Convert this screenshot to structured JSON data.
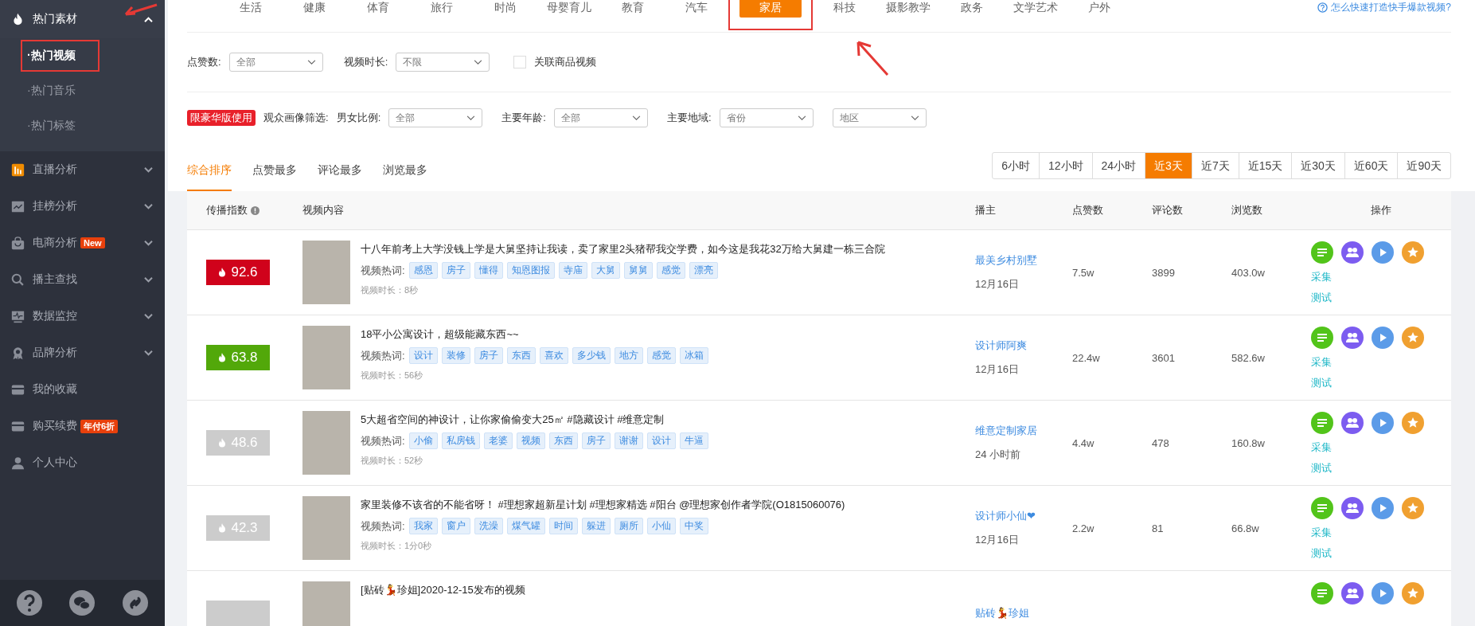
{
  "sidebar": {
    "items": [
      {
        "label": "热门素材",
        "selected": true,
        "expanded": true,
        "children": [
          {
            "label": "·热门视频",
            "selected": true,
            "highlighted": true
          },
          {
            "label": "·热门音乐",
            "selected": false,
            "highlighted": false
          },
          {
            "label": "·热门标签",
            "selected": false,
            "highlighted": false
          }
        ]
      },
      {
        "label": "直播分析",
        "selected": false,
        "expanded": false
      },
      {
        "label": "挂榜分析",
        "selected": false,
        "expanded": false
      },
      {
        "label": "电商分析",
        "selected": false,
        "expanded": false,
        "badge": "New"
      },
      {
        "label": "播主查找",
        "selected": false,
        "expanded": false
      },
      {
        "label": "数据监控",
        "selected": false,
        "expanded": false
      },
      {
        "label": "品牌分析",
        "selected": false,
        "expanded": false
      },
      {
        "label": "我的收藏",
        "selected": false
      },
      {
        "label": "购买续费",
        "selected": false,
        "badge": "年付6折"
      },
      {
        "label": "个人中心",
        "selected": false
      }
    ]
  },
  "categories": [
    {
      "label": "生活",
      "selected": false
    },
    {
      "label": "健康",
      "selected": false
    },
    {
      "label": "体育",
      "selected": false
    },
    {
      "label": "旅行",
      "selected": false
    },
    {
      "label": "时尚",
      "selected": false
    },
    {
      "label": "母婴育儿",
      "selected": false
    },
    {
      "label": "教育",
      "selected": false
    },
    {
      "label": "汽车",
      "selected": false
    },
    {
      "label": "家居",
      "selected": true,
      "highlighted": true
    },
    {
      "label": "科技",
      "selected": false
    },
    {
      "label": "摄影教学",
      "selected": false
    },
    {
      "label": "政务",
      "selected": false
    },
    {
      "label": "文学艺术",
      "selected": false
    },
    {
      "label": "户外",
      "selected": false
    }
  ],
  "help_link": "怎么快速打造快手爆款视频?",
  "filters": {
    "likes": {
      "label": "点赞数:",
      "value": "全部"
    },
    "duration": {
      "label": "视频时长:",
      "value": "不限"
    },
    "related_goods": {
      "label": "关联商品视频",
      "checked": false
    }
  },
  "audience": {
    "badge": "限豪华版使用",
    "label": "观众画像筛选:",
    "selects": [
      {
        "label": "男女比例:",
        "value": "全部"
      },
      {
        "label": "主要年龄:",
        "value": "全部"
      },
      {
        "label": "主要地域:",
        "value": "省份"
      },
      {
        "value": "地区"
      }
    ]
  },
  "sort_tabs": [
    {
      "label": "综合排序",
      "selected": true
    },
    {
      "label": "点赞最多",
      "selected": false
    },
    {
      "label": "评论最多",
      "selected": false
    },
    {
      "label": "浏览最多",
      "selected": false
    }
  ],
  "time_ranges": [
    {
      "label": "6小时",
      "selected": false
    },
    {
      "label": "12小时",
      "selected": false
    },
    {
      "label": "24小时",
      "selected": false
    },
    {
      "label": "近3天",
      "selected": true
    },
    {
      "label": "近7天",
      "selected": false
    },
    {
      "label": "近15天",
      "selected": false
    },
    {
      "label": "近30天",
      "selected": false
    },
    {
      "label": "近60天",
      "selected": false
    },
    {
      "label": "近90天",
      "selected": false
    }
  ],
  "table": {
    "columns": [
      "传播指数",
      "视频内容",
      "播主",
      "点赞数",
      "评论数",
      "浏览数",
      "操作"
    ],
    "rows": [
      {
        "score": "92.6",
        "color": "#d0021b",
        "title": "十八年前考上大学没钱上学是大舅坚持让我读，卖了家里2头猪帮我交学费，如今这是我花32万给大舅建一栋三合院",
        "keywords_label": "视频热词:",
        "keywords": [
          "感恩",
          "房子",
          "懂得",
          "知恩图报",
          "寺庙",
          "大舅",
          "舅舅",
          "感觉",
          "漂亮"
        ],
        "duration": "视频时长：8秒",
        "host": "最美乡村别墅",
        "date": "12月16日",
        "likes": "7.5w",
        "comments": "3899",
        "views": "403.0w",
        "actions": [
          "采集",
          "测试"
        ]
      },
      {
        "score": "63.8",
        "color": "#52a80a",
        "title": "18平小公寓设计，超级能藏东西~~",
        "keywords_label": "视频热词:",
        "keywords": [
          "设计",
          "装修",
          "房子",
          "东西",
          "喜欢",
          "多少钱",
          "地方",
          "感觉",
          "冰箱"
        ],
        "duration": "视频时长：56秒",
        "host": "设计师阿爽",
        "date": "12月16日",
        "likes": "22.4w",
        "comments": "3601",
        "views": "582.6w",
        "actions": [
          "采集",
          "测试"
        ]
      },
      {
        "score": "48.6",
        "color": "#cccccc",
        "title": "5大超省空间的神设计，让你家偷偷变大25㎡ #隐藏设计 #维意定制",
        "keywords_label": "视频热词:",
        "keywords": [
          "小偷",
          "私房钱",
          "老婆",
          "视频",
          "东西",
          "房子",
          "谢谢",
          "设计",
          "牛逼"
        ],
        "duration": "视频时长：52秒",
        "host": "维意定制家居",
        "date": "24 小时前",
        "likes": "4.4w",
        "comments": "478",
        "views": "160.8w",
        "actions": [
          "采集",
          "测试"
        ]
      },
      {
        "score": "42.3",
        "color": "#cccccc",
        "title": "家里装修不该省的不能省呀！ #理想家超新星计划 #理想家精选 #阳台 @理想家创作者学院(O1815060076)",
        "keywords_label": "视频热词:",
        "keywords": [
          "我家",
          "窗户",
          "洗澡",
          "煤气罐",
          "时间",
          "躲进",
          "厕所",
          "小仙",
          "中奖"
        ],
        "duration": "视频时长：1分0秒",
        "host": "设计师小仙❤",
        "date": "12月16日",
        "likes": "2.2w",
        "comments": "81",
        "views": "66.8w",
        "actions": [
          "采集",
          "测试"
        ]
      },
      {
        "color": "#cccccc",
        "title": "[贴砖💃珍姐]2020-12-15发布的视频",
        "host": "贴砖💃珍姐"
      }
    ]
  }
}
